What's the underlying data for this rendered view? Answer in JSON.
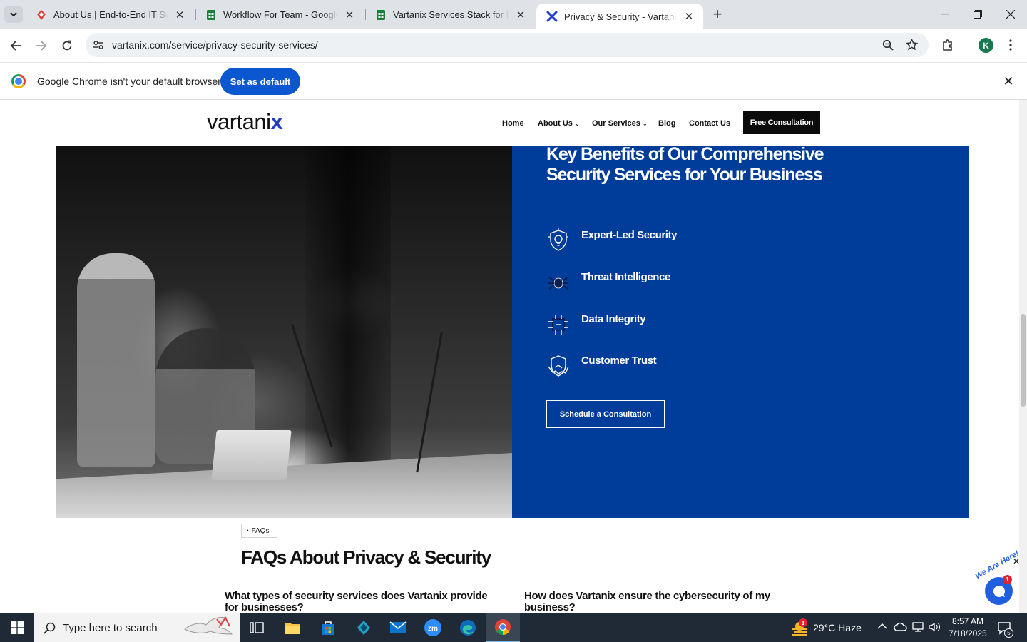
{
  "browser": {
    "tabs": [
      {
        "title": "About Us | End-to-End IT Soluti",
        "favicon": "vartanix-diamond-icon"
      },
      {
        "title": "Workflow For Team - Google Sh",
        "favicon": "sheets-icon"
      },
      {
        "title": "Vartanix Services Stack for Blog",
        "favicon": "sheets-icon"
      },
      {
        "title": "Privacy & Security - Vartanix",
        "favicon": "vartanix-x-icon",
        "active": true
      }
    ],
    "url": "vartanix.com/service/privacy-security-services/",
    "profile_initial": "K",
    "infobar": {
      "message": "Google Chrome isn't your default browser",
      "button": "Set as default"
    }
  },
  "site": {
    "logo": {
      "text": "vartani",
      "mark": "x"
    },
    "nav": [
      {
        "label": "Home",
        "dropdown": false
      },
      {
        "label": "About Us",
        "dropdown": true
      },
      {
        "label": "Our Services",
        "dropdown": true
      },
      {
        "label": "Blog",
        "dropdown": false
      },
      {
        "label": "Contact Us",
        "dropdown": false
      }
    ],
    "cta": "Free Consultation"
  },
  "hero": {
    "title": "Key Benefits of Our Comprehensive Security Services for Your Business",
    "benefits": [
      {
        "label": "Expert-Led Security",
        "icon": "shield-bulb-icon"
      },
      {
        "label": "Threat Intelligence",
        "icon": "spider-icon"
      },
      {
        "label": "Data Integrity",
        "icon": "circuit-icon"
      },
      {
        "label": "Customer Trust",
        "icon": "handshake-icon"
      }
    ],
    "button": "Schedule a Consultation",
    "panel_color": "#003c9a"
  },
  "faq": {
    "tag": "FAQs",
    "title": "FAQs About Privacy & Security",
    "questions": [
      "What types of security services does Vartanix provide for businesses?",
      "How does Vartanix ensure the cybersecurity of my business?"
    ]
  },
  "chat": {
    "badge": "1",
    "tagline": "We Are Here!"
  },
  "taskbar": {
    "search_placeholder": "Type here to search",
    "weather": "29°C  Haze",
    "weather_badge": "1",
    "time": "8:57 AM",
    "date": "7/18/2025",
    "notifications": "5"
  }
}
